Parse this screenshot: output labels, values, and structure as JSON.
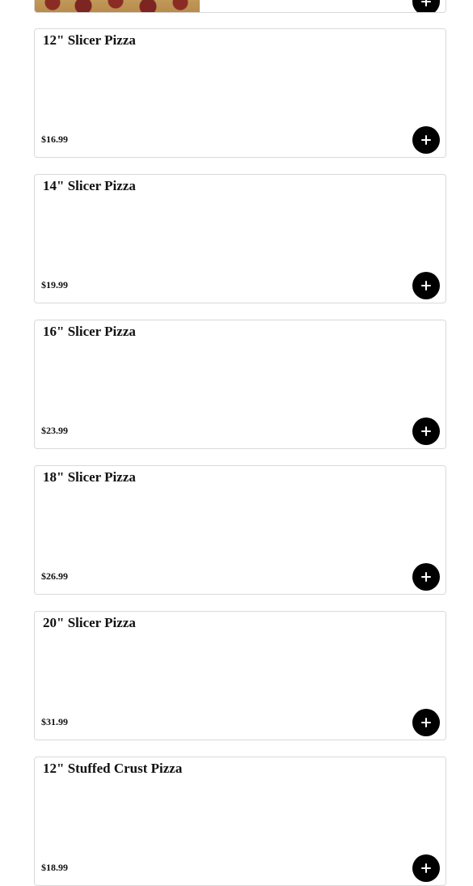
{
  "menu": {
    "items": [
      {
        "name": "12\" Slicer Pizza",
        "price": "$16.99"
      },
      {
        "name": "14\" Slicer Pizza",
        "price": "$19.99"
      },
      {
        "name": "16\" Slicer Pizza",
        "price": "$23.99"
      },
      {
        "name": "18\" Slicer Pizza",
        "price": "$26.99"
      },
      {
        "name": "20\" Slicer Pizza",
        "price": "$31.99"
      },
      {
        "name": "12\" Stuffed Crust Pizza",
        "price": "$18.99"
      }
    ]
  },
  "icons": {
    "add": "plus-icon"
  },
  "colors": {
    "button_bg": "#000000",
    "button_icon": "#ffffff",
    "card_border": "#d9d9d9",
    "text": "#111111"
  }
}
